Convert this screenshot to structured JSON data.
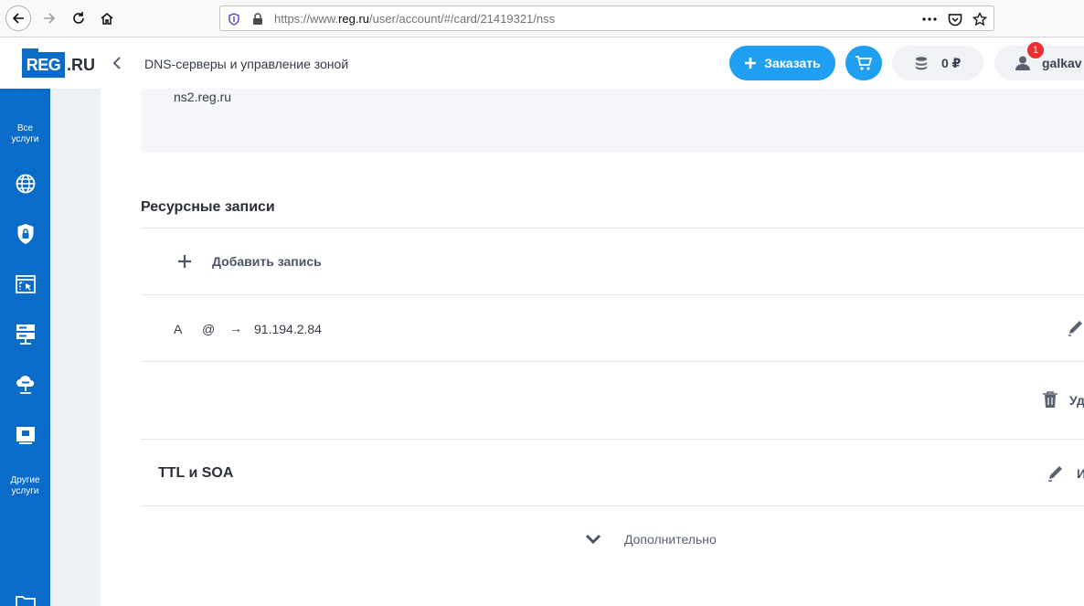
{
  "browser": {
    "url_prefix": "https://www.",
    "url_domain": "reg.ru",
    "url_path": "/user/account/#/card/21419321/nss"
  },
  "header": {
    "logo_main": "REG",
    "logo_suffix": ".RU",
    "page_title": "DNS-серверы и управление зоной",
    "order_label": "Заказать",
    "balance": "0 ₽",
    "notifications_count": "1",
    "username": "galkav"
  },
  "sidebar": {
    "all_services_label": "Все услуги",
    "other_services_label": "Другие услуги",
    "icons": [
      "globe-icon",
      "shield-lock-icon",
      "site-builder-icon",
      "server-icon",
      "cloud-server-icon",
      "certificate-icon",
      "folder-icon"
    ]
  },
  "content": {
    "ns_server": "ns2.reg.ru",
    "records_title": "Ресурсные записи",
    "add_record_label": "Добавить запись",
    "records": [
      {
        "type": "A",
        "host": "@",
        "arrow": "→",
        "value": "91.194.2.84"
      }
    ],
    "delete_label": "Уд",
    "ttl_soa_title": "TTL и SOA",
    "edit_label": "И",
    "more_label": "Дополнительно"
  },
  "colors": {
    "brand_blue": "#0b6bc9",
    "action_blue": "#1e9ff2",
    "badge_red": "#e8302f"
  }
}
